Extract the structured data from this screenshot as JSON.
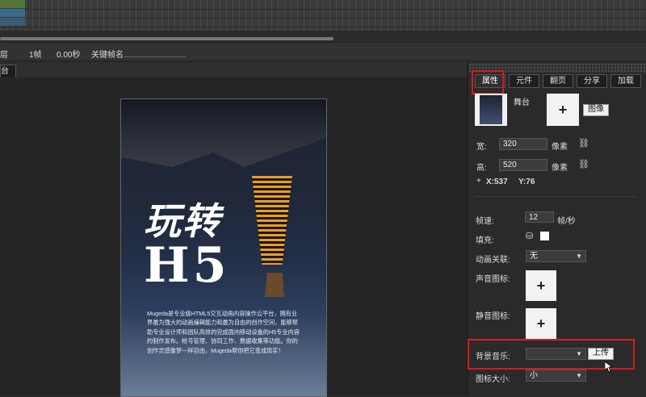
{
  "framebar": {
    "left_label": "层",
    "frame": "1帧",
    "seconds": "0.00秒",
    "keyframe_label": "关键帧名"
  },
  "stage": {
    "tab_label": "台",
    "poster_title_cn": "玩转",
    "poster_title_big": "H5",
    "poster_desc": "Mugeda是专业级HTML5交互动画内容操作云平台，拥有业界最为强大的动画编辑能力和最为自由的创作空间，能够帮助专业设计师和团队高效的完成面向移动设备的H5专业内容的制作发布。帐号管理、协同工作、数据收集等功能。你的创作灵感像梦一样自由，Mugeda帮你把它变成现实！"
  },
  "panel": {
    "tabs": [
      "属性",
      "元件",
      "翻页",
      "分享",
      "加载"
    ],
    "active_tab": "属性",
    "stage_name": "舞台",
    "image_button": "图像",
    "width_label": "宽:",
    "width_value": "320",
    "width_unit": "像素",
    "height_label": "高:",
    "height_value": "520",
    "height_unit": "像素",
    "coord_x": "X:537",
    "coord_y": "Y:76",
    "plus_sign": "+",
    "fps_label": "帧速:",
    "fps_value": "12",
    "fps_unit": "帧/秒",
    "fill_label": "填充:",
    "anim_link_label": "动画关联:",
    "anim_link_value": "无",
    "sound_icon_label": "声音图标:",
    "mute_icon_label": "静音图标:",
    "bg_music_label": "背景音乐:",
    "bg_music_value": "",
    "upload_button": "上传",
    "icon_size_label": "图标大小:",
    "icon_size_value": "小"
  },
  "colors": {
    "highlight": "#d61b1b",
    "tower_light": "#f6a51a"
  }
}
